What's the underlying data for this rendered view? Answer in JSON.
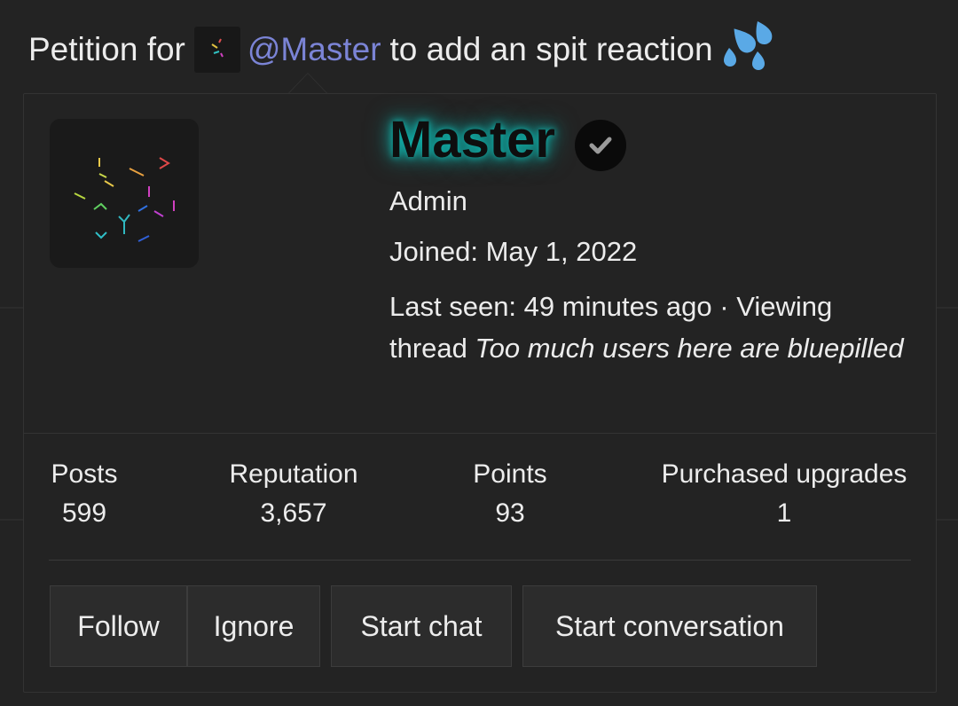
{
  "thread": {
    "title_prefix": "Petition for",
    "mention": "@Master",
    "title_suffix": "to add an spit reaction"
  },
  "profile": {
    "username": "Master",
    "role": "Admin",
    "joined_label": "Joined:",
    "joined_date": "May 1, 2022",
    "last_seen_label": "Last seen:",
    "last_seen_value": "49 minutes ago",
    "activity": "· Viewing thread",
    "activity_thread": "Too much users here are bluepilled"
  },
  "stats": [
    {
      "label": "Posts",
      "value": "599"
    },
    {
      "label": "Reputation",
      "value": "3,657"
    },
    {
      "label": "Points",
      "value": "93"
    },
    {
      "label": "Purchased upgrades",
      "value": "1"
    }
  ],
  "actions": {
    "follow": "Follow",
    "ignore": "Ignore",
    "start_chat": "Start chat",
    "start_conversation": "Start conversation"
  },
  "colors": {
    "accent_mention": "#7b84d6",
    "username_glow": "#0fb7b0",
    "drops": "#5aa9e6"
  },
  "icons": [
    "sweat-droplets-icon",
    "verified-check-icon"
  ]
}
